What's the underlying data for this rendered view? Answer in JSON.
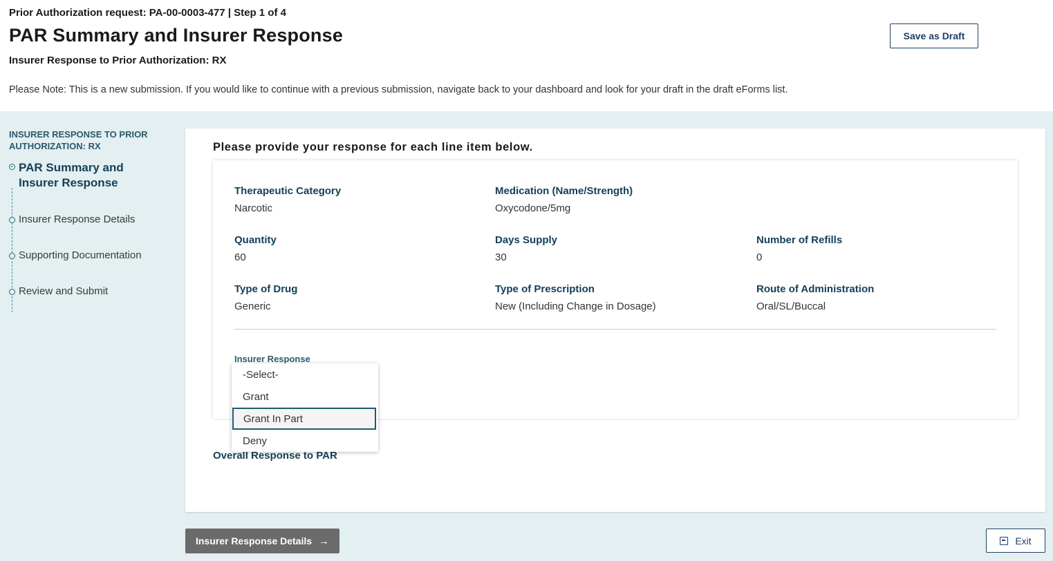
{
  "header": {
    "request_line": "Prior Authorization request: PA-00-0003-477 | Step 1 of 4",
    "title": "PAR Summary and Insurer Response",
    "subtitle": "Insurer Response to Prior Authorization: RX",
    "note": "Please Note: This is a new submission. If you would like to continue with a previous submission, navigate back to your dashboard and look for your draft in the draft eForms list.",
    "save_draft_label": "Save as Draft"
  },
  "sidebar": {
    "heading": "INSURER RESPONSE TO PRIOR AUTHORIZATION: RX",
    "steps": [
      {
        "label": "PAR Summary and Insurer Response",
        "active": true
      },
      {
        "label": "Insurer Response Details",
        "active": false
      },
      {
        "label": "Supporting Documentation",
        "active": false
      },
      {
        "label": "Review and Submit",
        "active": false
      }
    ]
  },
  "main": {
    "instruction": "Please provide your response for each line item below.",
    "line_item": {
      "therapeutic_category": {
        "label": "Therapeutic Category",
        "value": "Narcotic"
      },
      "medication": {
        "label": "Medication (Name/Strength)",
        "value": "Oxycodone/5mg"
      },
      "quantity": {
        "label": "Quantity",
        "value": "60"
      },
      "days_supply": {
        "label": "Days Supply",
        "value": "30"
      },
      "refills": {
        "label": "Number of Refills",
        "value": "0"
      },
      "drug_type": {
        "label": "Type of Drug",
        "value": "Generic"
      },
      "prescription_type": {
        "label": "Type of Prescription",
        "value": "New (Including Change in Dosage)"
      },
      "route": {
        "label": "Route of Administration",
        "value": "Oral/SL/Buccal"
      }
    },
    "insurer_response": {
      "label": "Insurer Response",
      "options": [
        "-Select-",
        "Grant",
        "Grant In Part",
        "Deny"
      ],
      "highlighted": "Grant In Part"
    },
    "overall_response_label": "Overall Response to PAR"
  },
  "footer": {
    "next_label": "Insurer Response Details",
    "next_icon": "arrow-right-icon",
    "exit_label": "Exit",
    "exit_icon": "exit-icon"
  }
}
